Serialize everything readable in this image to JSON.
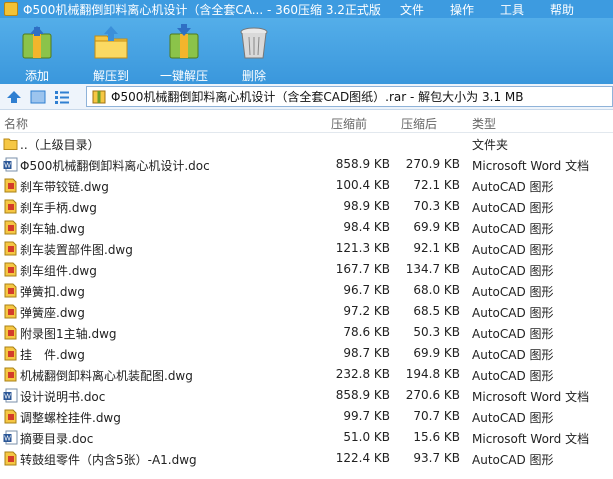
{
  "window": {
    "title": "Φ500机械翻倒卸料离心机设计（含全套CA... - 360压缩 3.2正式版",
    "menu": [
      "文件",
      "操作",
      "工具",
      "帮助"
    ]
  },
  "toolbar": {
    "add": "添加",
    "extract_to": "解压到",
    "one_click": "一键解压",
    "delete": "删除"
  },
  "address": {
    "path": "Φ500机械翻倒卸料离心机设计（含全套CAD图纸）.rar - 解包大小为 3.1 MB"
  },
  "columns": {
    "name": "名称",
    "packed": "压缩前",
    "compressed": "压缩后",
    "type": "类型"
  },
  "colors": {
    "titlebar": "#3d9be0",
    "toolbar": "#4aa5e6",
    "word": "#2b5797",
    "dwg": "#d33c2a"
  },
  "files": [
    {
      "name": "..（上级目录）",
      "packed": "",
      "compressed": "",
      "type": "文件夹",
      "icon": "folder-icon"
    },
    {
      "name": "Φ500机械翻倒卸料离心机设计.doc",
      "packed": "858.9 KB",
      "compressed": "270.9 KB",
      "type": "Microsoft Word 文档",
      "icon": "word-doc-icon"
    },
    {
      "name": "刹车带铰链.dwg",
      "packed": "100.4 KB",
      "compressed": "72.1 KB",
      "type": "AutoCAD 图形",
      "icon": "dwg-file-icon"
    },
    {
      "name": "刹车手柄.dwg",
      "packed": "98.9 KB",
      "compressed": "70.3 KB",
      "type": "AutoCAD 图形",
      "icon": "dwg-file-icon"
    },
    {
      "name": "刹车轴.dwg",
      "packed": "98.4 KB",
      "compressed": "69.9 KB",
      "type": "AutoCAD 图形",
      "icon": "dwg-file-icon"
    },
    {
      "name": "刹车装置部件图.dwg",
      "packed": "121.3 KB",
      "compressed": "92.1 KB",
      "type": "AutoCAD 图形",
      "icon": "dwg-file-icon"
    },
    {
      "name": "刹车组件.dwg",
      "packed": "167.7 KB",
      "compressed": "134.7 KB",
      "type": "AutoCAD 图形",
      "icon": "dwg-file-icon"
    },
    {
      "name": "弹簧扣.dwg",
      "packed": "96.7 KB",
      "compressed": "68.0 KB",
      "type": "AutoCAD 图形",
      "icon": "dwg-file-icon"
    },
    {
      "name": "弹簧座.dwg",
      "packed": "97.2 KB",
      "compressed": "68.5 KB",
      "type": "AutoCAD 图形",
      "icon": "dwg-file-icon"
    },
    {
      "name": "附录图1主轴.dwg",
      "packed": "78.6 KB",
      "compressed": "50.3 KB",
      "type": "AutoCAD 图形",
      "icon": "dwg-file-icon"
    },
    {
      "name": "挂　件.dwg",
      "packed": "98.7 KB",
      "compressed": "69.9 KB",
      "type": "AutoCAD 图形",
      "icon": "dwg-file-icon"
    },
    {
      "name": "机械翻倒卸料离心机装配图.dwg",
      "packed": "232.8 KB",
      "compressed": "194.8 KB",
      "type": "AutoCAD 图形",
      "icon": "dwg-file-icon"
    },
    {
      "name": "设计说明书.doc",
      "packed": "858.9 KB",
      "compressed": "270.6 KB",
      "type": "Microsoft Word 文档",
      "icon": "word-doc-icon"
    },
    {
      "name": "调整螺栓挂件.dwg",
      "packed": "99.7 KB",
      "compressed": "70.7 KB",
      "type": "AutoCAD 图形",
      "icon": "dwg-file-icon"
    },
    {
      "name": "摘要目录.doc",
      "packed": "51.0 KB",
      "compressed": "15.6 KB",
      "type": "Microsoft Word 文档",
      "icon": "word-doc-icon"
    },
    {
      "name": "转鼓组零件（内含5张）-A1.dwg",
      "packed": "122.4 KB",
      "compressed": "93.7 KB",
      "type": "AutoCAD 图形",
      "icon": "dwg-file-icon"
    }
  ]
}
